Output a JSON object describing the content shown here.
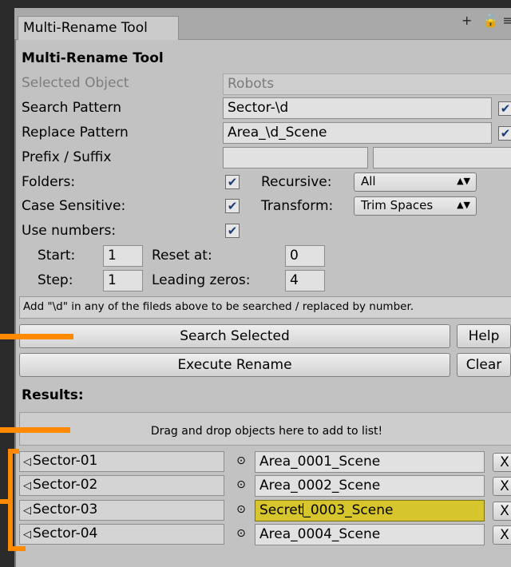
{
  "tab": {
    "title": "Multi-Rename Tool",
    "add_icon": "+",
    "lock_icon": "lock-icon",
    "menu_icon": "menu-icon"
  },
  "header": {
    "title": "Multi-Rename Tool"
  },
  "form": {
    "selected_object": {
      "label": "Selected Object",
      "value": "Robots"
    },
    "search_pattern": {
      "label": "Search Pattern",
      "value": "Sector-\\d"
    },
    "replace_pattern": {
      "label": "Replace Pattern",
      "value": "Area_\\d_Scene"
    },
    "prefix_suffix": {
      "label": "Prefix / Suffix",
      "prefix": "",
      "suffix": ""
    },
    "folders": {
      "label": "Folders:",
      "checked": true
    },
    "recursive": {
      "label": "Recursive:",
      "value": "All"
    },
    "case_sensitive": {
      "label": "Case Sensitive:",
      "checked": true
    },
    "transform": {
      "label": "Transform:",
      "value": "Trim Spaces"
    },
    "use_numbers": {
      "label": "Use numbers:",
      "checked": true
    },
    "start": {
      "label": "Start:",
      "value": "1"
    },
    "reset_at": {
      "label": "Reset at:",
      "value": "0"
    },
    "step": {
      "label": "Step:",
      "value": "1"
    },
    "leading_zeros": {
      "label": "Leading zeros:",
      "value": "4"
    }
  },
  "note": "Add \"\\d\" in any of the fileds above to be searched / replaced by number.",
  "buttons": {
    "search_selected": "Search Selected",
    "help": "Help",
    "execute_rename": "Execute Rename",
    "clear": "Clear"
  },
  "results": {
    "title": "Results:",
    "dropzone": "Drag and drop objects here to add to list!",
    "rows": [
      {
        "source": "Sector-01",
        "target": "Area_0001_Scene",
        "remove": "X"
      },
      {
        "source": "Sector-02",
        "target": "Area_0002_Scene",
        "remove": "X"
      },
      {
        "source": "Sector-03",
        "target_a": "Secret",
        "target_b": "_0003_Scene",
        "remove": "X",
        "highlight_color": "#d6c52c"
      },
      {
        "source": "Sector-04",
        "target": "Area_0004_Scene",
        "remove": "X"
      }
    ]
  },
  "colors": {
    "annotation": "#ff8a00",
    "panel": "#c2c2c2",
    "background": "#2b2b2b"
  }
}
